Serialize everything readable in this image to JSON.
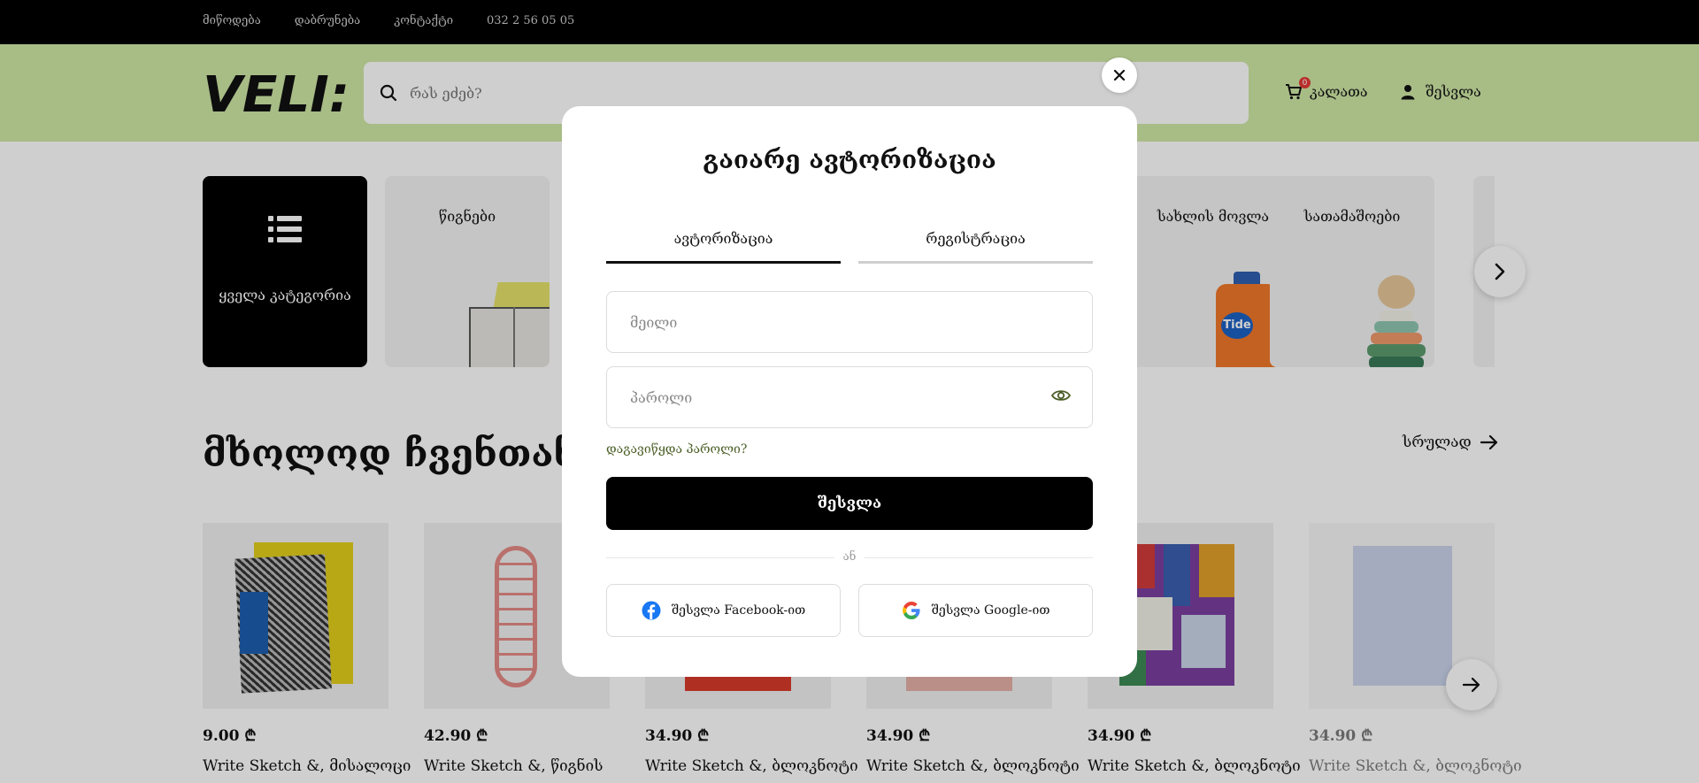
{
  "topbar": {
    "links": [
      "მიწოდება",
      "დაბრუნება",
      "კონტაქტი",
      "032 2 56 05 05"
    ]
  },
  "header": {
    "logo_text": "VELI:",
    "search_placeholder": "რას ეძებ?",
    "cart_label": "კალათა",
    "cart_count": "0",
    "login_label": "შესვლა"
  },
  "categories": [
    {
      "label": "ყველა კატეგორია",
      "icon": "list-icon"
    },
    {
      "label": "წიგნები"
    },
    {
      "label": "სახლის მოვლა"
    },
    {
      "label": "სათამაშოები"
    }
  ],
  "section": {
    "title": "მხოლოდ ჩვენთან Write Sketch &",
    "see_all": "სრულად"
  },
  "products": [
    {
      "price": "9.00 ₾",
      "name": "Write Sketch &, მისალოცი"
    },
    {
      "price": "42.90 ₾",
      "name": "Write Sketch &, წიგნის"
    },
    {
      "price": "34.90 ₾",
      "name": "Write Sketch &, ბლოკნოტი"
    },
    {
      "price": "34.90 ₾",
      "name": "Write Sketch &, ბლოკნოტი"
    },
    {
      "price": "34.90 ₾",
      "name": "Write Sketch &, ბლოკნოტი"
    },
    {
      "price": "34.90 ₾",
      "name": "Write Sketch &, ბლოკნოტი"
    }
  ],
  "modal": {
    "title": "გაიარე ავტორიზაცია",
    "tab_login": "ავტორიზაცია",
    "tab_register": "რეგისტრაცია",
    "email_placeholder": "მეილი",
    "password_placeholder": "პაროლი",
    "forgot": "დაგავიწყდა პაროლი?",
    "submit": "შესვლა",
    "or": "ან",
    "facebook": "შესვლა Facebook-ით",
    "google": "შესვლა Google-ით"
  },
  "colors": {
    "header_bg": "#cfe8a6",
    "topbar_bg": "#000000",
    "accent_dark": "#4a5e26",
    "facebook_blue": "#1877f2"
  }
}
